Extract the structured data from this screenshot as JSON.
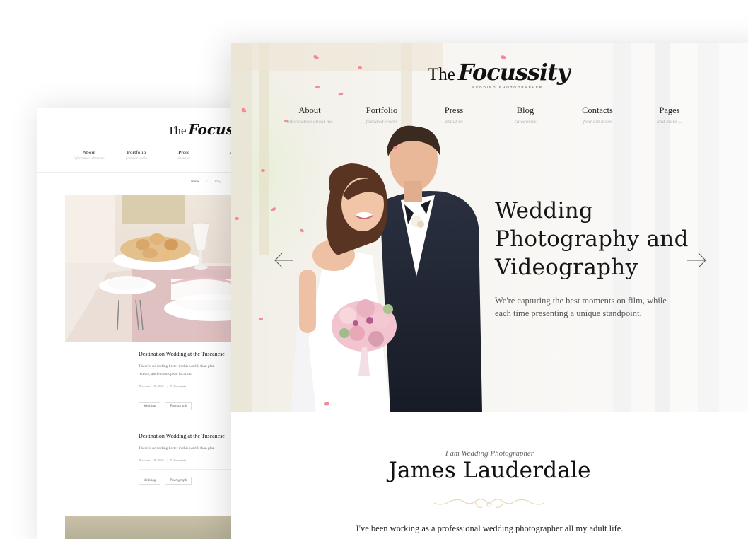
{
  "back_page": {
    "logo": {
      "the": "The",
      "script": "Focuss"
    },
    "nav": [
      {
        "label": "About",
        "sub": "information about me"
      },
      {
        "label": "Portfolio",
        "sub": "featured works"
      },
      {
        "label": "Press",
        "sub": "about us"
      },
      {
        "label": "Bl",
        "sub": "cat"
      }
    ],
    "breadcrumbs": {
      "home": "Home",
      "separator": "/",
      "current": "Blog"
    },
    "posts": [
      {
        "title": "Destination Wedding at the Tuscanese",
        "excerpt_line1": "There is no feeling better in this world, than plan",
        "excerpt_line2": "remote, ancient european location.",
        "date": "December 15, 2016",
        "comments": "5 Comments",
        "tags": [
          "Wedding",
          "Photograph"
        ]
      },
      {
        "title": "Destination Wedding at the Tuscanese",
        "excerpt_line1": "There is no feeling better in this world, than plan",
        "excerpt_line2": "remote, ancient european location.",
        "date": "December 15, 2016",
        "comments": "5 Comments",
        "tags": [
          "Wedding",
          "Photograph"
        ]
      }
    ]
  },
  "front_page": {
    "logo": {
      "the": "The",
      "script": "Focussity",
      "tagline": "WEDDING PHOTOGRAPHER"
    },
    "nav": [
      {
        "label": "About",
        "sub": "information about me"
      },
      {
        "label": "Portfolio",
        "sub": "featured works"
      },
      {
        "label": "Press",
        "sub": "about us"
      },
      {
        "label": "Blog",
        "sub": "categories"
      },
      {
        "label": "Contacts",
        "sub": "find out more"
      },
      {
        "label": "Pages",
        "sub": "and more ..."
      }
    ],
    "hero": {
      "title_line1": "Wedding",
      "title_line2": "Photography and",
      "title_line3": "Videography",
      "desc_line1": "We're capturing the best moments on film, while",
      "desc_line2": "each time presenting a unique standpoint."
    },
    "intro": {
      "small": "I am Wedding Photographer",
      "name": "James Lauderdale",
      "text": "I've been working as a professional wedding photographer all my adult life."
    }
  },
  "icons": {
    "prev": "arrow-left-icon",
    "next": "arrow-right-icon",
    "flourish": "flourish-ornament-icon"
  },
  "colors": {
    "accent_gold": "#e7d9b8",
    "petal_pink": "#f08a9c",
    "suit_navy": "#1f2433"
  }
}
